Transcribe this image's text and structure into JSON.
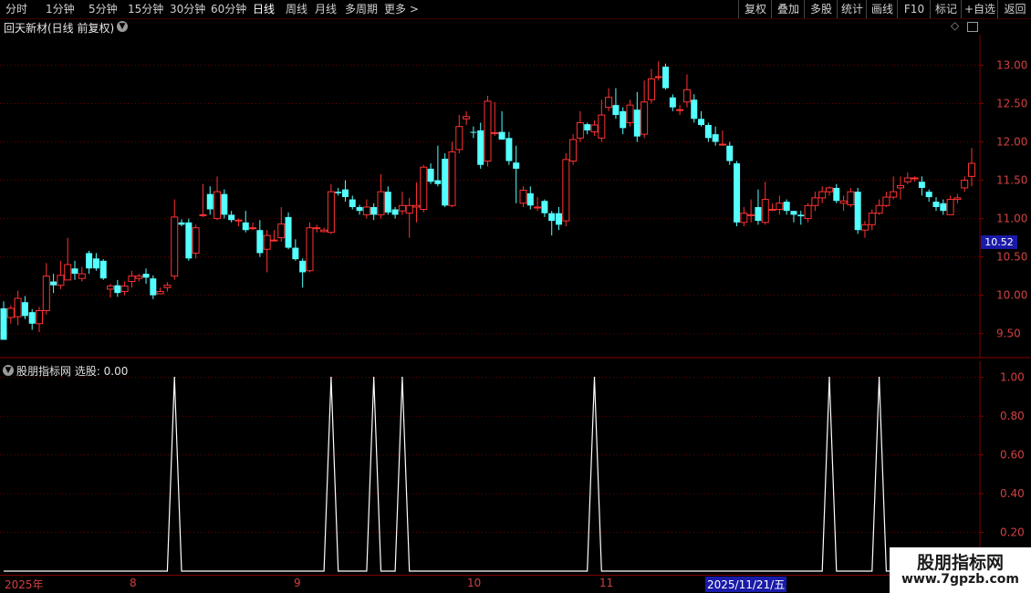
{
  "toolbar": {
    "periods": [
      "分时",
      "1分钟",
      "5分钟",
      "15分钟",
      "30分钟",
      "60分钟",
      "日线",
      "周线",
      "月线",
      "多周期",
      "更多 >"
    ],
    "active_period": "日线",
    "right_buttons": [
      "复权",
      "叠加",
      "多股",
      "统计",
      "画线",
      "F10",
      "标记",
      "+自选",
      "返回"
    ]
  },
  "chart_title": {
    "stock": "回天新材(日线 前复权)"
  },
  "indicator": {
    "title": "股朋指标网  选股: 0.00"
  },
  "price_tag": "10.52",
  "x_axis": {
    "labels": [
      "2025年",
      "8",
      "9",
      "10",
      "11"
    ],
    "highlight": "2025/11/21/五"
  },
  "watermark": {
    "title": "股朋指标网",
    "url": "www.7gpzb.com"
  },
  "colors": {
    "up": "#ff3232",
    "down": "#54ffff",
    "axis": "#800000",
    "grid": "#6a0000",
    "signal": "#ffffff",
    "highlight_bg": "#1a1aa8"
  },
  "chart_data": [
    {
      "type": "candlestick",
      "y_ticks": [
        "13.00",
        "12.50",
        "12.00",
        "11.50",
        "11.00",
        "10.50",
        "10.00",
        "9.50"
      ],
      "ylim": [
        9.33,
        13.35
      ],
      "candles": [
        [
          9.83,
          9.42,
          9.92,
          9.42
        ],
        [
          9.71,
          9.83,
          9.87,
          9.63
        ],
        [
          9.72,
          9.96,
          10.06,
          9.61
        ],
        [
          9.91,
          9.73,
          9.99,
          9.69
        ],
        [
          9.78,
          9.63,
          9.82,
          9.55
        ],
        [
          9.63,
          9.8,
          9.85,
          9.52
        ],
        [
          9.8,
          10.25,
          10.42,
          9.75
        ],
        [
          10.18,
          10.13,
          10.28,
          10.03
        ],
        [
          10.13,
          10.26,
          10.45,
          10.08
        ],
        [
          10.2,
          10.4,
          10.75
        ],
        [
          10.35,
          10.28,
          10.45,
          10.2
        ],
        [
          10.22,
          10.28,
          10.37,
          10.18
        ],
        [
          10.55,
          10.35,
          10.58,
          10.28
        ],
        [
          10.48,
          10.35,
          10.55,
          10.32
        ],
        [
          10.45,
          10.22,
          10.47,
          10.2
        ],
        [
          10.08,
          10.12,
          10.15,
          9.97
        ],
        [
          10.13,
          10.03,
          10.2,
          9.98
        ],
        [
          10.05,
          10.12,
          10.18,
          10.0
        ],
        [
          10.18,
          10.25,
          10.32,
          10.1
        ],
        [
          10.22,
          10.25,
          10.28,
          10.18
        ],
        [
          10.28,
          10.23,
          10.35,
          10.15
        ],
        [
          10.22,
          10.0,
          10.26,
          9.95
        ],
        [
          10.02,
          10.05,
          10.1,
          10.02
        ],
        [
          10.1,
          10.13,
          10.17,
          10.05
        ],
        [
          10.25,
          11.02,
          11.25,
          10.2
        ],
        [
          10.95,
          10.92,
          10.99,
          10.9
        ],
        [
          10.95,
          10.48,
          11.0,
          10.45
        ],
        [
          10.55,
          10.88,
          10.92,
          10.48
        ],
        [
          11.05,
          11.05,
          11.45,
          11.02
        ],
        [
          11.32,
          11.12,
          11.42,
          11.05
        ],
        [
          11.0,
          11.35,
          11.55,
          10.98
        ],
        [
          11.32,
          11.05,
          11.38,
          11.0
        ],
        [
          11.05,
          10.98,
          11.1,
          10.95
        ],
        [
          10.98,
          10.98,
          11.0,
          10.9
        ],
        [
          10.95,
          10.85,
          11.1,
          10.82
        ],
        [
          10.88,
          10.88,
          10.95,
          10.85
        ],
        [
          10.85,
          10.55,
          10.98,
          10.5
        ],
        [
          10.6,
          10.78,
          10.85,
          10.3
        ],
        [
          10.72,
          10.72,
          10.85,
          10.7
        ],
        [
          10.75,
          10.93,
          11.15,
          10.7
        ],
        [
          11.02,
          10.62,
          11.08,
          10.6
        ],
        [
          10.62,
          10.47,
          10.73,
          10.45
        ],
        [
          10.45,
          10.3,
          10.48,
          10.1
        ],
        [
          10.32,
          10.88,
          10.95,
          10.3
        ],
        [
          10.87,
          10.88,
          10.92,
          10.82
        ],
        [
          10.83,
          10.85,
          10.88,
          10.82
        ],
        [
          10.82,
          11.35,
          11.45,
          10.8
        ],
        [
          11.35,
          11.33,
          11.4,
          11.3
        ],
        [
          11.38,
          11.28,
          11.5,
          11.22
        ],
        [
          11.25,
          11.15,
          11.3,
          11.12
        ],
        [
          11.15,
          11.1,
          11.18,
          11.05
        ],
        [
          11.05,
          11.15,
          11.25,
          11.0
        ],
        [
          11.15,
          11.05,
          11.2,
          10.98
        ],
        [
          11.05,
          11.35,
          11.58,
          11.0
        ],
        [
          11.35,
          11.08,
          11.42,
          11.05
        ],
        [
          11.12,
          11.05,
          11.15,
          11.0
        ],
        [
          11.1,
          11.17,
          11.35,
          11.05
        ],
        [
          11.07,
          11.17,
          11.27,
          10.75
        ],
        [
          11.15,
          11.17,
          11.47,
          10.95
        ],
        [
          11.12,
          11.67,
          11.7,
          11.08
        ],
        [
          11.65,
          11.48,
          11.72,
          11.45
        ],
        [
          11.5,
          11.45,
          11.95,
          11.42
        ],
        [
          11.78,
          11.17,
          11.85,
          11.15
        ],
        [
          11.17,
          11.87,
          12.0,
          11.15
        ],
        [
          11.9,
          12.2,
          12.35,
          11.85
        ],
        [
          12.3,
          12.33,
          12.4,
          12.22
        ],
        [
          12.13,
          12.12,
          12.2,
          12.05
        ],
        [
          12.15,
          11.7,
          12.25,
          11.65
        ],
        [
          11.75,
          12.53,
          12.6,
          11.68
        ],
        [
          12.12,
          12.12,
          12.52,
          12.08
        ],
        [
          12.13,
          12.03,
          12.4,
          12.05
        ],
        [
          12.05,
          11.75,
          12.13,
          11.7
        ],
        [
          11.73,
          11.65,
          11.95,
          11.2
        ],
        [
          11.2,
          11.37,
          11.42,
          11.15
        ],
        [
          11.33,
          11.17,
          11.42,
          11.12
        ],
        [
          11.15,
          11.15,
          11.28,
          11.1
        ],
        [
          11.23,
          11.07,
          11.25,
          11.02
        ],
        [
          11.07,
          10.97,
          11.1,
          10.78
        ],
        [
          11.07,
          10.92,
          11.15,
          10.85
        ],
        [
          10.97,
          11.77,
          11.85,
          10.9
        ],
        [
          11.75,
          12.03,
          12.1,
          11.7
        ],
        [
          12.05,
          12.25,
          12.4,
          12.0
        ],
        [
          12.23,
          12.15,
          12.25,
          12.1
        ],
        [
          12.13,
          12.22,
          12.28,
          12.08
        ],
        [
          12.05,
          12.35,
          12.55,
          12.0
        ],
        [
          12.45,
          12.58,
          12.7,
          12.4
        ],
        [
          12.48,
          12.35,
          12.7,
          12.3
        ],
        [
          12.4,
          12.18,
          12.45,
          12.1
        ],
        [
          12.25,
          12.48,
          12.55,
          12.2
        ],
        [
          12.42,
          12.07,
          12.65,
          12.0
        ],
        [
          12.1,
          12.52,
          12.8,
          12.05
        ],
        [
          12.55,
          12.82,
          12.95,
          12.5
        ],
        [
          12.85,
          12.85,
          13.05,
          12.8
        ],
        [
          12.98,
          12.7,
          13.02,
          12.68
        ],
        [
          12.58,
          12.45,
          12.62,
          12.4
        ],
        [
          12.42,
          12.42,
          12.48,
          12.35
        ],
        [
          12.52,
          12.68,
          12.88,
          12.45
        ],
        [
          12.55,
          12.3,
          12.62,
          12.25
        ],
        [
          12.3,
          12.22,
          12.4,
          12.2
        ],
        [
          12.22,
          12.05,
          12.25,
          12.0
        ],
        [
          12.1,
          12.0,
          12.2,
          11.95
        ],
        [
          11.97,
          11.97,
          12.15,
          11.95
        ],
        [
          11.95,
          11.75,
          12.0,
          11.7
        ],
        [
          11.72,
          10.95,
          11.75,
          10.9
        ],
        [
          10.95,
          11.07,
          11.15,
          10.9
        ],
        [
          11.05,
          11.05,
          11.25,
          10.95
        ],
        [
          11.15,
          10.97,
          11.38,
          10.92
        ],
        [
          10.95,
          11.25,
          11.48,
          10.92
        ],
        [
          11.12,
          11.12,
          11.2,
          11.1
        ],
        [
          11.12,
          11.2,
          11.3,
          11.05
        ],
        [
          11.22,
          11.1,
          11.25,
          11.05
        ],
        [
          11.1,
          11.05,
          11.1,
          10.95
        ],
        [
          11.05,
          11.03,
          11.1,
          10.92
        ],
        [
          11.0,
          11.17,
          11.2,
          10.95
        ],
        [
          11.17,
          11.27,
          11.35,
          11.1
        ],
        [
          11.27,
          11.35,
          11.42,
          11.2
        ],
        [
          11.35,
          11.4,
          11.42,
          11.3
        ],
        [
          11.4,
          11.23,
          11.45,
          11.2
        ],
        [
          11.2,
          11.23,
          11.3,
          11.1
        ],
        [
          11.18,
          11.35,
          11.4,
          11.15
        ],
        [
          11.35,
          10.85,
          11.4,
          10.8
        ],
        [
          10.85,
          10.92,
          10.97,
          10.75
        ],
        [
          10.92,
          11.07,
          11.12,
          10.85
        ],
        [
          11.07,
          11.17,
          11.25,
          11.05
        ],
        [
          11.17,
          11.28,
          11.35,
          11.15
        ],
        [
          11.28,
          11.35,
          11.55,
          11.25
        ],
        [
          11.4,
          11.43,
          11.55,
          11.25
        ],
        [
          11.48,
          11.53,
          11.6,
          11.45
        ],
        [
          11.52,
          11.53,
          11.55,
          11.48
        ],
        [
          11.48,
          11.4,
          11.55,
          11.3
        ],
        [
          11.35,
          11.28,
          11.38,
          11.22
        ],
        [
          11.22,
          11.15,
          11.28,
          11.1
        ],
        [
          11.2,
          11.1,
          11.25,
          11.05
        ],
        [
          11.05,
          11.25,
          11.3,
          11.05
        ],
        [
          11.25,
          11.27,
          11.32,
          11.2
        ],
        [
          11.4,
          11.5,
          11.55,
          11.35
        ],
        [
          11.55,
          11.72,
          11.92,
          11.42
        ]
      ]
    },
    {
      "type": "line",
      "name": "选股",
      "y_ticks": [
        "1.00",
        "0.80",
        "0.60",
        "0.40",
        "0.20"
      ],
      "ylim": [
        0,
        1.06
      ],
      "spike_bar_indexes": [
        24,
        46,
        52,
        56,
        83,
        116,
        123
      ],
      "values_note": "1 at spike bars, 0 elsewhere"
    }
  ]
}
